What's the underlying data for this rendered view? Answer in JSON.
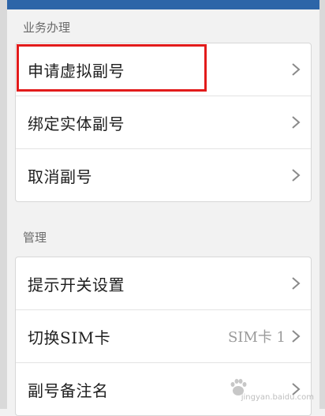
{
  "sections": [
    {
      "title": "业务办理",
      "items": [
        {
          "label": "申请虚拟副号",
          "value": ""
        },
        {
          "label": "绑定实体副号",
          "value": ""
        },
        {
          "label": "取消副号",
          "value": ""
        }
      ]
    },
    {
      "title": "管理",
      "items": [
        {
          "label": "提示开关设置",
          "value": ""
        },
        {
          "label": "切换SIM卡",
          "value": "SIM卡 1"
        },
        {
          "label": "副号备注名",
          "value": ""
        }
      ]
    }
  ],
  "watermark": {
    "text": "jingyan.baidu.com"
  },
  "colors": {
    "highlight": "#e21b1b",
    "topbar": "#2d65a8"
  },
  "icons": {
    "chevron": "chevron-right-icon",
    "watermark": "baidu-paw-icon"
  }
}
